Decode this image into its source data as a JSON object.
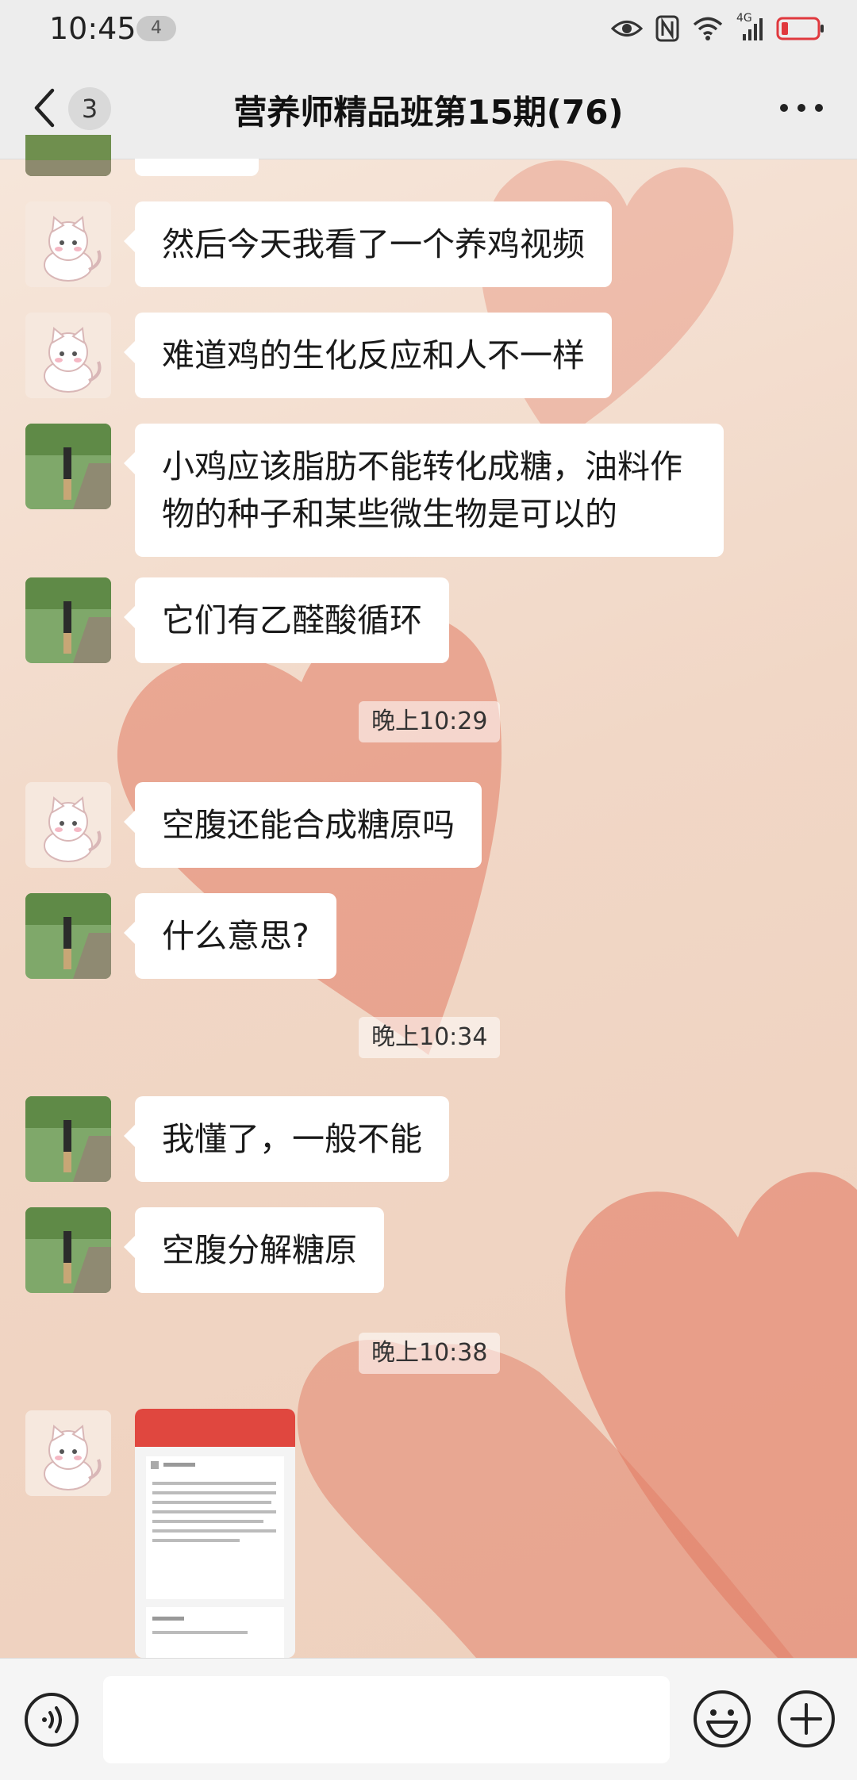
{
  "status_bar": {
    "time": "10:45",
    "notification_count": "4",
    "network": "4G"
  },
  "nav": {
    "unread_count": "3",
    "title": "营养师精品班第15期(76)"
  },
  "messages": [
    {
      "sender": "cat",
      "text": "然后今天我看了一个养鸡视频"
    },
    {
      "sender": "cat",
      "text": "难道鸡的生化反应和人不一样"
    },
    {
      "sender": "field",
      "text": "小鸡应该脂肪不能转化成糖，油料作物的种子和某些微生物是可以的"
    },
    {
      "sender": "field",
      "text": "它们有乙醛酸循环"
    },
    {
      "type": "time",
      "text": "晚上10:29"
    },
    {
      "sender": "cat",
      "text": "空腹还能合成糖原吗"
    },
    {
      "sender": "field",
      "text": "什么意思?"
    },
    {
      "type": "time",
      "text": "晚上10:34"
    },
    {
      "sender": "field",
      "text": "我懂了，一般不能"
    },
    {
      "sender": "field",
      "text": "空腹分解糖原"
    },
    {
      "type": "time",
      "text": "晚上10:38"
    },
    {
      "sender": "cat",
      "type": "image"
    }
  ],
  "colors": {
    "nav_bg": "#ededed",
    "bubble_bg": "#ffffff",
    "heart": "#e07a62",
    "battery_low": "#e0393e"
  }
}
